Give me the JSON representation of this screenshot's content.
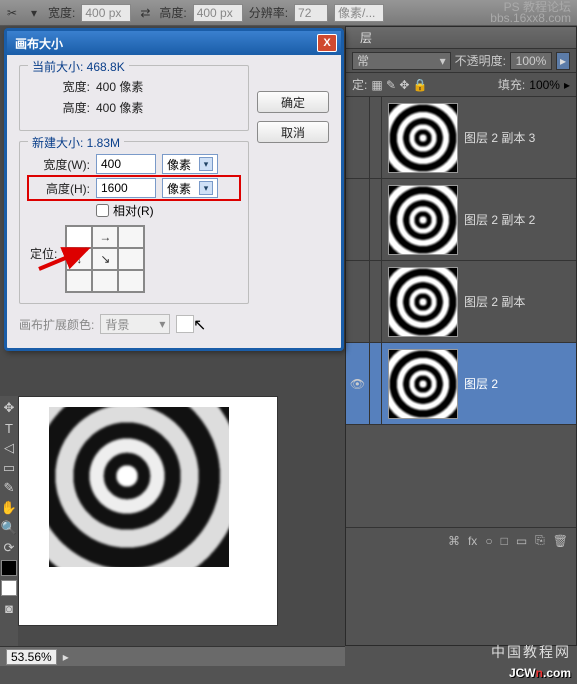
{
  "topbar": {
    "width_label": "宽度:",
    "width_value": "400 px",
    "height_label": "高度:",
    "height_value": "400 px",
    "res_label": "分辨率:",
    "res_value": "72",
    "unit_label": "像素/..."
  },
  "watermark_top": {
    "l1": "PS 教程论坛",
    "l2": "bbs.16xx8.com"
  },
  "dialog": {
    "title": "画布大小",
    "close": "X",
    "ok": "确定",
    "cancel": "取消",
    "current": {
      "group": "当前大小: 468.8K",
      "width_k": "宽度:",
      "width_v": "400 像素",
      "height_k": "高度:",
      "height_v": "400 像素"
    },
    "new": {
      "group": "新建大小: 1.83M",
      "width_k": "宽度(W):",
      "width_v": "400",
      "width_unit": "像素",
      "height_k": "高度(H):",
      "height_v": "1600",
      "height_unit": "像素",
      "relative": "相对(R)",
      "anchor_k": "定位:"
    },
    "extend": {
      "k": "画布扩展颜色:",
      "v": "背景"
    }
  },
  "layers": {
    "tab": "层",
    "blend": "常",
    "opacity_k": "不透明度:",
    "opacity_v": "100%",
    "lock_k": "定:",
    "fill_k": "填充:",
    "fill_v": "100%",
    "items": [
      {
        "name": "图层 2 副本 3"
      },
      {
        "name": "图层 2 副本 2"
      },
      {
        "name": "图层 2 副本"
      },
      {
        "name": "图层 2"
      }
    ],
    "footer_icons": [
      "fx",
      "○",
      "□",
      "▭",
      "⎘",
      "🗑"
    ]
  },
  "status": {
    "zoom": "53.56%"
  },
  "watermark_bottom": {
    "cn": "中国教程网",
    "en1": "JCW",
    "en2": "n",
    "en3": ".com"
  }
}
